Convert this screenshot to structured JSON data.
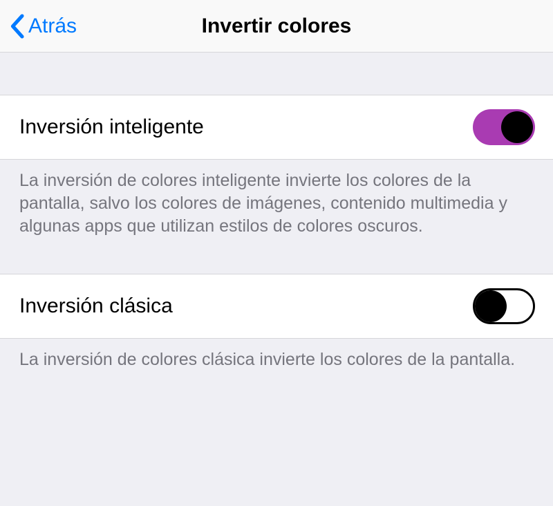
{
  "header": {
    "back_label": "Atrás",
    "title": "Invertir colores"
  },
  "sections": {
    "smart": {
      "label": "Inversión inteligente",
      "enabled": true,
      "description": "La inversión de colores inteligente invierte los colores de la pantalla, salvo los colores de imágenes, contenido multimedia y algunas apps que utilizan estilos de colores oscuros."
    },
    "classic": {
      "label": "Inversión clásica",
      "enabled": false,
      "description": "La inversión de colores clásica invierte los colores de la pantalla."
    }
  },
  "colors": {
    "accent": "#007aff",
    "toggle_on": "#a93bb2"
  }
}
